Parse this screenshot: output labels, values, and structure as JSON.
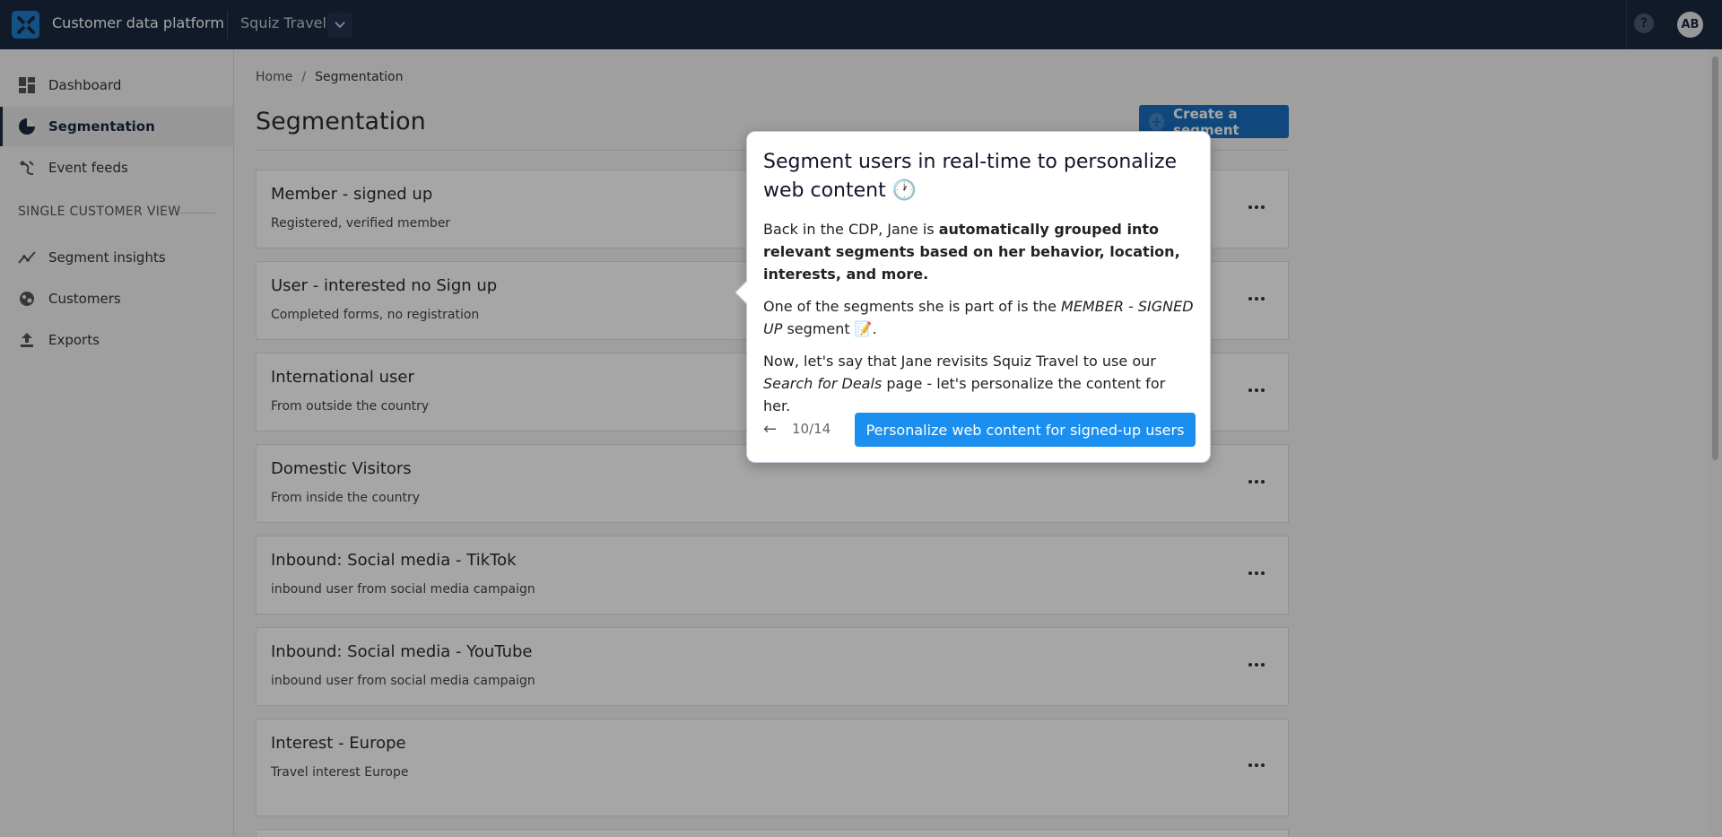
{
  "topbar": {
    "app_title": "Customer data platform",
    "workspace": "Squiz Travel",
    "help_glyph": "?",
    "avatar_initials": "AB"
  },
  "sidebar": {
    "items": [
      {
        "label": "Dashboard",
        "icon": "dashboard-icon"
      },
      {
        "label": "Segmentation",
        "icon": "pie-chart-icon",
        "active": true
      },
      {
        "label": "Event feeds",
        "icon": "event-feed-icon"
      }
    ],
    "section_heading": "SINGLE CUSTOMER VIEW",
    "section_items": [
      {
        "label": "Segment insights",
        "icon": "trend-line-icon"
      },
      {
        "label": "Customers",
        "icon": "customers-globe-icon"
      },
      {
        "label": "Exports",
        "icon": "upload-icon"
      }
    ]
  },
  "breadcrumb": {
    "home": "Home",
    "separator": "/",
    "current": "Segmentation"
  },
  "page": {
    "title": "Segmentation",
    "create_button": "Create a segment"
  },
  "segments": [
    {
      "name": "Member - signed up",
      "description": "Registered, verified member"
    },
    {
      "name": "User - interested no Sign up",
      "description": "Completed forms, no registration"
    },
    {
      "name": "International user",
      "description": "From outside the country"
    },
    {
      "name": "Domestic Visitors",
      "description": "From inside the country"
    },
    {
      "name": "Inbound: Social media - TikTok",
      "description": "inbound user from social media campaign"
    },
    {
      "name": "Inbound: Social media - YouTube",
      "description": "inbound user from social media campaign"
    },
    {
      "name": "Interest - Europe",
      "description": "Travel interest Europe"
    }
  ],
  "popover": {
    "title": "Segment users in real-time to personalize web content 🕐",
    "p1_prefix": "Back in the CDP, Jane is ",
    "p1_bold": "automatically grouped into relevant segments based on her behavior, location, interests, and more.",
    "p2_prefix": "One of the segments she is part of is the ",
    "p2_italic": "MEMBER - SIGNED UP",
    "p2_suffix": " segment 📝.",
    "p3_prefix": "Now, let's say that Jane revisits Squiz Travel to use our ",
    "p3_italic": "Search for Deals",
    "p3_suffix": " page - let's personalize the content for her.",
    "back": "←",
    "step": "10/14",
    "cta": "Personalize web content for signed-up users"
  },
  "colors": {
    "topbar": "#1b2940",
    "primary": "#1a6fc2",
    "cta": "#1a8ff0"
  }
}
